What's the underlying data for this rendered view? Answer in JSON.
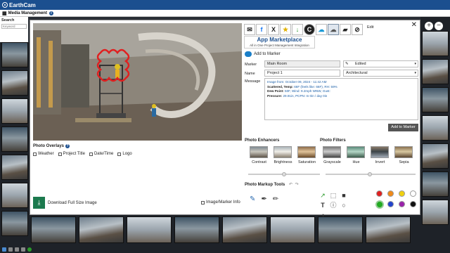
{
  "app": {
    "brand": "EarthCam",
    "section": "Media Management"
  },
  "search": {
    "label": "Search",
    "placeholder": "Keyword"
  },
  "share_icons": [
    "mail-icon",
    "facebook-icon",
    "x-icon",
    "star-icon",
    "download-arrow-icon",
    "salesforce-icon",
    "cloud-upload-icon",
    "road-icon",
    "link-icon"
  ],
  "edit_label": "Edit",
  "app_marketplace": {
    "title": "App Marketplace",
    "subtitle": "All in One Project Management Integration"
  },
  "add_to_marker": "Add to Marker",
  "form": {
    "marker_label": "Marker",
    "marker_value": "Main Room",
    "marker_type_value": "Edited",
    "name_label": "Name",
    "name_value": "Project 1",
    "category_value": "Architectural",
    "message_label": "Message",
    "message_lines": [
      {
        "key": "Image from: ",
        "val": "October 09, 2024 - 11:42 AM"
      },
      {
        "key": "Scattered, Temp: ",
        "val": "66F (feels like: 66F), RH: 59%"
      },
      {
        "key": "Dew Point: ",
        "val": "50F, Wind: 9.2mph WNW, Gust: "
      },
      {
        "key": "Pressure: ",
        "val": "29.91in, PCPN: In 0in / day 0in"
      }
    ],
    "submit": "Add to Marker"
  },
  "overlays": {
    "title": "Photo Overlays",
    "options": [
      "Weather",
      "Project Title",
      "Date/Time",
      "Logo"
    ]
  },
  "download": {
    "label": "Download Full Size Image"
  },
  "image_marker_info": "Image/Marker Info",
  "enhancers": {
    "title": "Photo Enhancers",
    "items": [
      "Contrast",
      "Brightness",
      "Saturation"
    ]
  },
  "filters": {
    "title": "Photo Filters",
    "items": [
      "Grayscale",
      "Hue",
      "Invert",
      "Sepia"
    ]
  },
  "markup": {
    "title": "Photo Markup Tools"
  },
  "colors": [
    "#e02020",
    "#f08a1a",
    "#f0d010",
    "#ffffff",
    "#22aa22",
    "#2244cc",
    "#9922aa",
    "#111111"
  ]
}
